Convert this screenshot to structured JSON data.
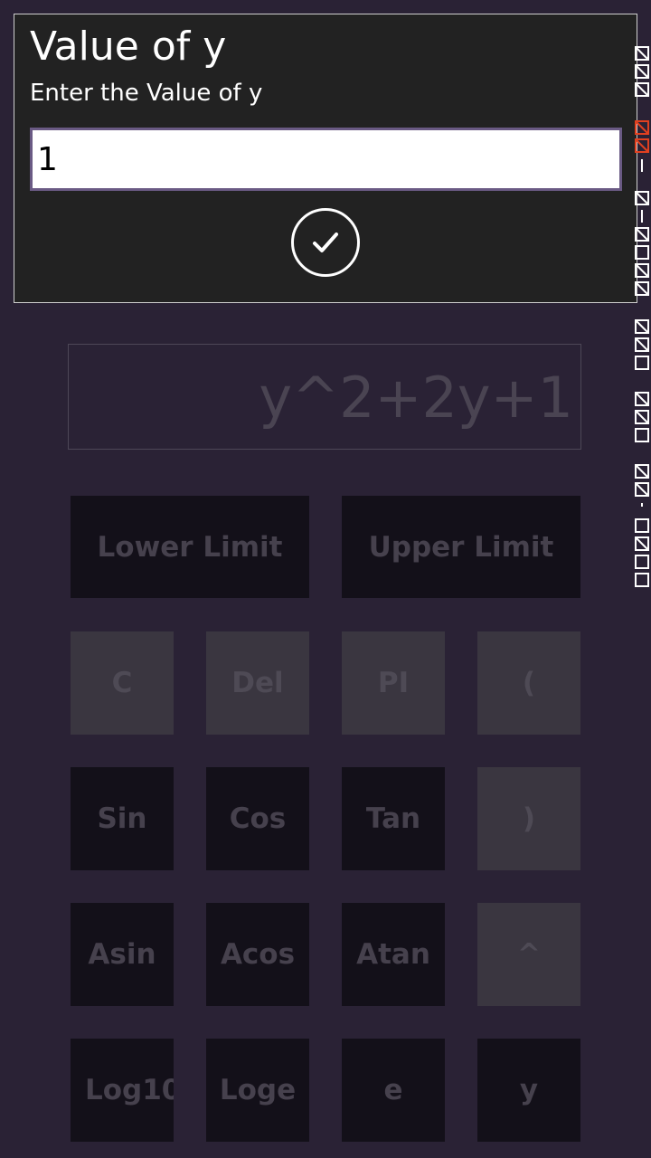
{
  "dialog": {
    "title": "Value of y",
    "subtitle": "Enter the Value of y",
    "input_value": "1",
    "confirm_icon": "checkmark-circle-icon"
  },
  "calculator": {
    "expression": "y^2+2y+1",
    "limits": {
      "lower_label": "Lower Limit",
      "upper_label": "Upper Limit"
    },
    "rows": [
      [
        "C",
        "Del",
        "PI",
        "("
      ],
      [
        "Sin",
        "Cos",
        "Tan",
        ")"
      ],
      [
        "Asin",
        "Acos",
        "Atan",
        "^"
      ],
      [
        "Log10",
        "Loge",
        "e",
        "y"
      ]
    ]
  },
  "colors": {
    "background": "#2a2235",
    "dialog_background": "#222222",
    "input_border": "#6a5a84",
    "dark_button": "#131019",
    "gray_button": "#3a3640"
  }
}
